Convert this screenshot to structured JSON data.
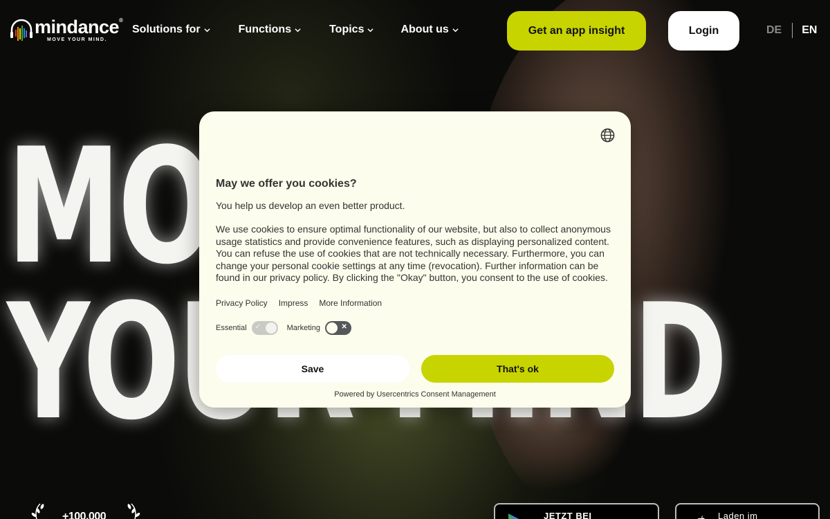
{
  "brand": {
    "name": "mindance",
    "tagline": "MOVE YOUR MIND.",
    "registered": "®",
    "accent_color": "#c8d400"
  },
  "nav": {
    "items": [
      {
        "label": "Solutions for",
        "icon": "chevron-down-icon"
      },
      {
        "label": "Functions",
        "icon": "chevron-down-icon"
      },
      {
        "label": "Topics",
        "icon": "chevron-down-icon"
      },
      {
        "label": "About us",
        "icon": "chevron-down-icon"
      }
    ],
    "cta_label": "Get an app insight",
    "login_label": "Login",
    "languages": [
      "DE",
      "EN"
    ],
    "active_language": "EN"
  },
  "hero": {
    "line1": "MOVE",
    "line2": "YOUR MIND"
  },
  "bottom": {
    "users_count": "+100.000",
    "google_store_label": "JETZT BEI",
    "apple_store_label": "Laden im"
  },
  "cookie_dialog": {
    "title": "May we offer you cookies?",
    "subtitle": "You help us develop an even better product.",
    "body": "We use cookies to ensure optimal functionality of our website, but also to collect anonymous usage statistics and provide convenience features, such as displaying personalized content. You can refuse the use of cookies that are not technically necessary. Furthermore, you can change your personal cookie settings at any time (revocation). Further information can be found in our privacy policy. By clicking the \"Okay\" button, you consent to the use of cookies.",
    "links": [
      "Privacy Policy",
      "Impress",
      "More Information"
    ],
    "toggles": [
      {
        "label": "Essential",
        "state": "on",
        "disabled": true
      },
      {
        "label": "Marketing",
        "state": "off",
        "disabled": false
      }
    ],
    "save_label": "Save",
    "accept_label": "That's ok",
    "powered_by": "Powered by Usercentrics Consent Management",
    "language_icon": "globe-icon"
  }
}
